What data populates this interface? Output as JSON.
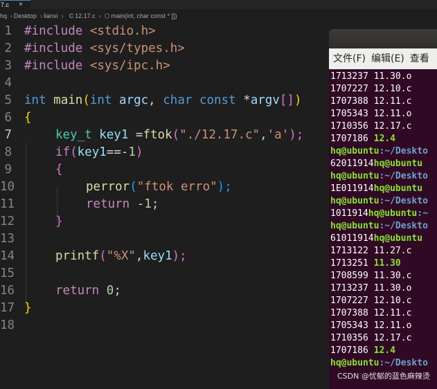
{
  "editor": {
    "tab": {
      "label": "7.c",
      "close": "×"
    },
    "breadcrumb": {
      "items": [
        "hq",
        "Desktop",
        "lianxi"
      ],
      "file": "12.17.c",
      "file_icon": "C",
      "symbol": "main(int, char const * [])",
      "sep": "›"
    },
    "lines": [
      {
        "n": "1"
      },
      {
        "n": "2"
      },
      {
        "n": "3"
      },
      {
        "n": "4"
      },
      {
        "n": "5"
      },
      {
        "n": "6"
      },
      {
        "n": "7"
      },
      {
        "n": "8"
      },
      {
        "n": "9"
      },
      {
        "n": "10"
      },
      {
        "n": "11"
      },
      {
        "n": "12"
      },
      {
        "n": "13"
      },
      {
        "n": "14"
      },
      {
        "n": "15"
      },
      {
        "n": "16"
      },
      {
        "n": "17"
      },
      {
        "n": "18"
      }
    ],
    "code": {
      "l1": [
        "#include",
        " <stdio.h>"
      ],
      "l2": [
        "#include",
        " <sys/types.h>"
      ],
      "l3": [
        "#include",
        " <sys/ipc.h>"
      ],
      "l5": [
        "int",
        " ",
        "main",
        "(",
        "int",
        " ",
        "argc",
        ", ",
        "char",
        " ",
        "const",
        " *",
        "argv",
        "[]",
        ")"
      ],
      "l6": [
        "{"
      ],
      "l7": [
        "key_t",
        " ",
        "key1",
        " =",
        "ftok",
        "(",
        "\"./12.17.c\"",
        ",",
        "'a'",
        ");"
      ],
      "l8": [
        "if",
        "(",
        "key1",
        "==-",
        "1",
        ")"
      ],
      "l9": [
        "{"
      ],
      "l10": [
        "perror",
        "(",
        "\"ftok erro\"",
        ");"
      ],
      "l11": [
        "return",
        " -",
        "1",
        ";"
      ],
      "l12": [
        "}"
      ],
      "l14": [
        "printf",
        "(",
        "\"%X\"",
        ",",
        "key1",
        ");"
      ],
      "l16": [
        "return",
        " ",
        "0",
        ";"
      ],
      "l17": [
        "}"
      ]
    }
  },
  "terminal": {
    "menu": [
      "文件(F)",
      "编辑(E)",
      "查看"
    ],
    "lines": [
      {
        "a": "1713237 11.30.o",
        "hl": ""
      },
      {
        "a": "1707227 12.10.c",
        "hl": ""
      },
      {
        "a": "1707388 12.11.c",
        "hl": ""
      },
      {
        "a": "1705343 12.11.o",
        "hl": ""
      },
      {
        "a": "1710356 12.17.c",
        "hl": ""
      },
      {
        "a": "1707186 ",
        "hl": "12.4"
      },
      {
        "prompt": "hq@ubuntu",
        "path": ":~/Deskto"
      },
      {
        "a": "62011914",
        "prompt": "hq@ubuntu"
      },
      {
        "prompt": "hq@ubuntu",
        "path": ":~/Deskto"
      },
      {
        "a": "1E011914",
        "prompt": "hq@ubuntu"
      },
      {
        "prompt": "hq@ubuntu",
        "path": ":~/Deskto"
      },
      {
        "a": "1011914",
        "prompt": "hq@ubuntu",
        "path": ":~"
      },
      {
        "prompt": "hq@ubuntu",
        "path": ":~/Deskto"
      },
      {
        "a": "61011914",
        "prompt": "hq@ubuntu"
      },
      {
        "a": "1713122 11.27.c",
        "hl": ""
      },
      {
        "a": "1713251 ",
        "hl": "11.30"
      },
      {
        "a": "1708599 11.30.c",
        "hl": ""
      },
      {
        "a": "1713237 11.30.o",
        "hl": ""
      },
      {
        "a": "1707227 12.10.c",
        "hl": ""
      },
      {
        "a": "1707388 12.11.c",
        "hl": ""
      },
      {
        "a": "1705343 12.11.o",
        "hl": ""
      },
      {
        "a": "1710356 12.17.c",
        "hl": ""
      },
      {
        "a": "1707186 ",
        "hl": "12.4"
      },
      {
        "prompt": "hq@ubuntu",
        "path": ":~/Deskto"
      }
    ]
  },
  "watermark": "CSDN @忧郁的蓝色麻辣烫"
}
